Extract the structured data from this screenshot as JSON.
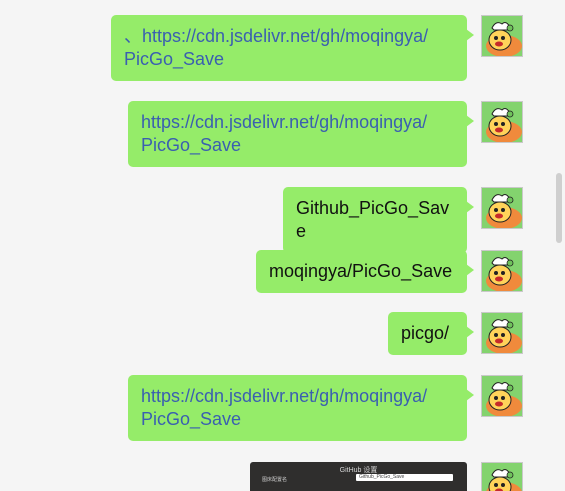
{
  "messages": [
    {
      "type": "link",
      "lines": [
        "、https://cdn.jsdelivr.net/gh/moqingya/",
        "PicGo_Save"
      ]
    },
    {
      "type": "link",
      "lines": [
        "https://cdn.jsdelivr.net/gh/moqingya/",
        "PicGo_Save"
      ]
    },
    {
      "type": "text",
      "text": "Github_PicGo_Save"
    },
    {
      "type": "text",
      "text": "moqingya/PicGo_Save"
    },
    {
      "type": "text",
      "text": "picgo/"
    },
    {
      "type": "link",
      "lines": [
        "https://cdn.jsdelivr.net/gh/moqingya/",
        "PicGo_Save"
      ]
    },
    {
      "type": "image",
      "title": "GitHub 设置",
      "label": "图床配置名",
      "field_value": "Github_PicGo_Save"
    }
  ],
  "avatar": {
    "icon": "cartoon-avatar-icon"
  },
  "colors": {
    "bubble": "#95ec69",
    "link": "#3a5fb0",
    "background": "#f5f5f5"
  }
}
